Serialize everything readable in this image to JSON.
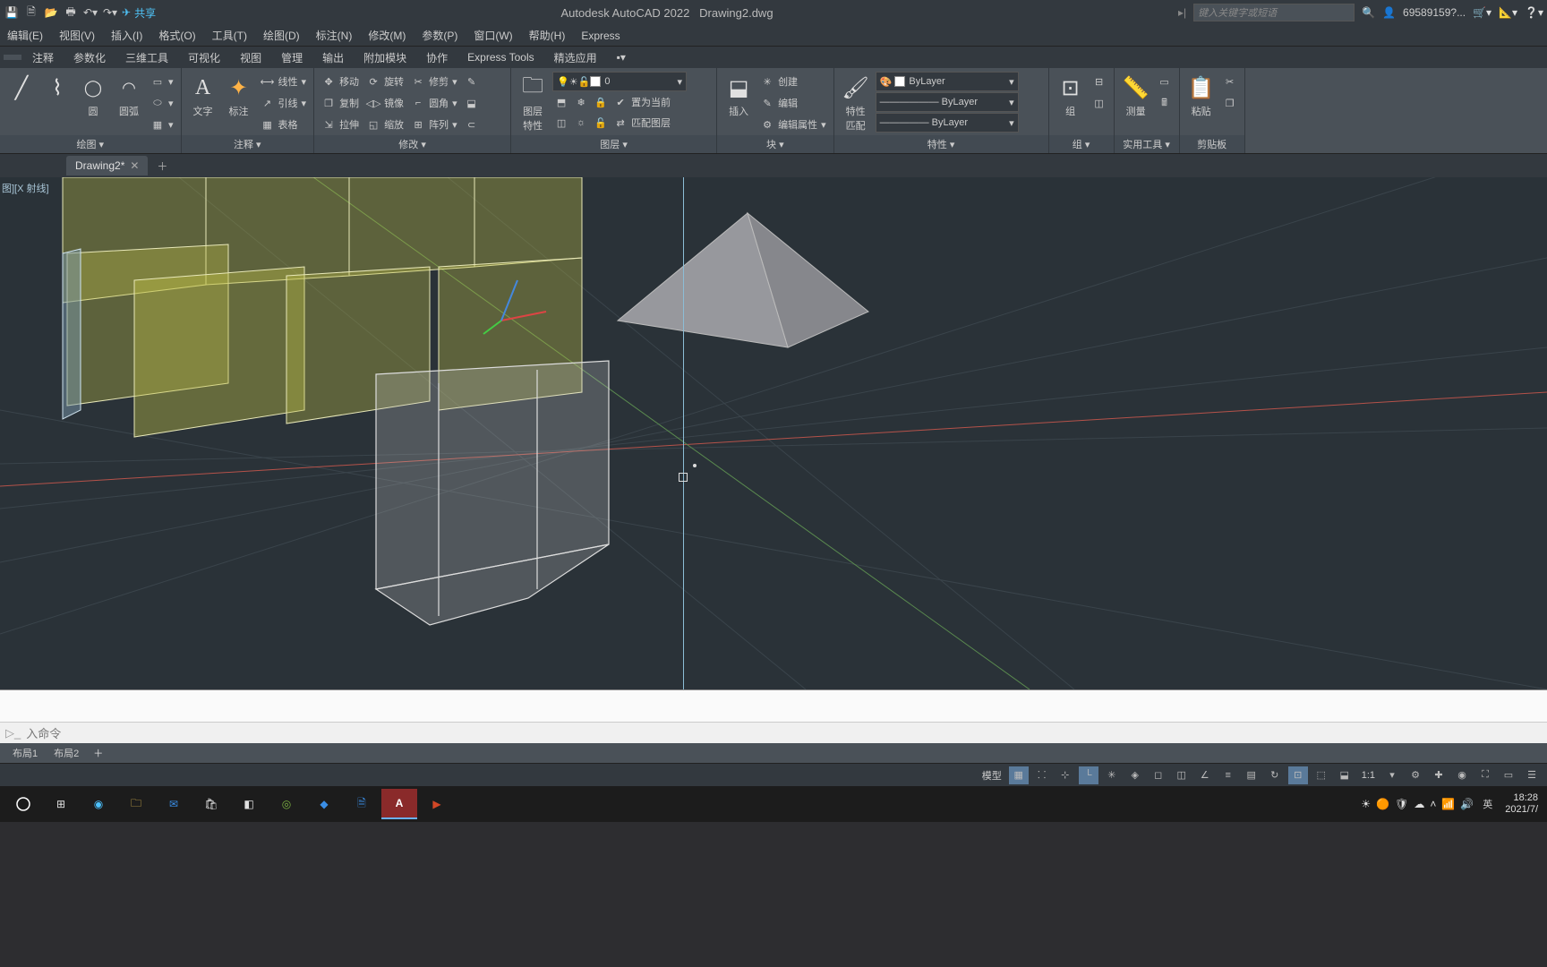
{
  "title": {
    "app": "Autodesk AutoCAD 2022",
    "file": "Drawing2.dwg"
  },
  "share": "共享",
  "search_placeholder": "键入关键字或短语",
  "username": "69589159?...",
  "menubar": [
    "编辑(E)",
    "视图(V)",
    "插入(I)",
    "格式(O)",
    "工具(T)",
    "绘图(D)",
    "标注(N)",
    "修改(M)",
    "参数(P)",
    "窗口(W)",
    "帮助(H)",
    "Express"
  ],
  "ribbon_tabs": [
    "",
    "注释",
    "参数化",
    "三维工具",
    "可视化",
    "视图",
    "管理",
    "输出",
    "附加模块",
    "协作",
    "Express Tools",
    "精选应用"
  ],
  "active_tab_index": 0,
  "panels": {
    "draw": {
      "title": "绘图 ▾",
      "circle": "圆",
      "arc": "圆弧"
    },
    "annot": {
      "title": "注释 ▾",
      "text": "文字",
      "dim": "标注",
      "table": "表格"
    },
    "modify": {
      "title": "修改 ▾",
      "r0": [
        "移动",
        "旋转",
        "修剪"
      ],
      "r1": [
        "复制",
        "镜像",
        "圆角"
      ],
      "r2": [
        "拉伸",
        "缩放",
        "阵列"
      ],
      "line": "线性",
      "lead": "引线"
    },
    "layer": {
      "title": "图层 ▾",
      "props": "图层\n特性",
      "current": "0",
      "setcur": "置为当前",
      "match": "匹配图层"
    },
    "block": {
      "title": "块 ▾",
      "insert": "插入",
      "create": "创建",
      "edit": "编辑",
      "editattr": "编辑属性"
    },
    "props": {
      "title": "特性 ▾",
      "match": "特性\n匹配",
      "color": "ByLayer",
      "ltype": "—————— ByLayer",
      "lweight": "————— ByLayer"
    },
    "group": {
      "title": "组 ▾",
      "group": "组"
    },
    "util": {
      "title": "实用工具 ▾",
      "measure": "测量"
    },
    "clip": {
      "title": "剪贴板",
      "paste": "粘贴"
    }
  },
  "doctab": "Drawing2*",
  "viewport_label": "图][X 射线]",
  "cmd_prompt": "入命令",
  "layout_tabs": [
    "布局1",
    "布局2"
  ],
  "status": {
    "model": "模型",
    "scale": "1:1",
    "ime": "英"
  },
  "clock": {
    "time": "18:28",
    "date": "2021/7/"
  }
}
